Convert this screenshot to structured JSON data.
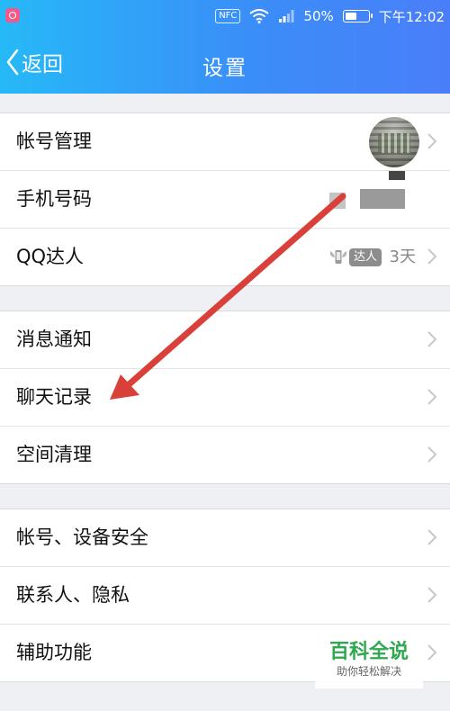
{
  "status_bar": {
    "nfc": "NFC",
    "battery": "50%",
    "time": "下午12:02"
  },
  "nav": {
    "back_label": "返回",
    "title": "设置"
  },
  "groups": [
    {
      "items": [
        {
          "label": "帐号管理"
        },
        {
          "label": "手机号码"
        },
        {
          "label": "QQ达人",
          "badge": "达人",
          "days": "3天"
        }
      ]
    },
    {
      "items": [
        {
          "label": "消息通知"
        },
        {
          "label": "聊天记录"
        },
        {
          "label": "空间清理"
        }
      ]
    },
    {
      "items": [
        {
          "label": "帐号、设备安全"
        },
        {
          "label": "联系人、隐私"
        },
        {
          "label": "辅助功能"
        }
      ]
    }
  ],
  "annotation": {
    "arrow_color": "#d9403a"
  },
  "watermark": {
    "title": "百科全说",
    "subtitle": "助你轻松解决"
  },
  "colors": {
    "header_start": "#26b9f7",
    "header_end": "#4a7ef9",
    "background": "#eff0f3"
  }
}
